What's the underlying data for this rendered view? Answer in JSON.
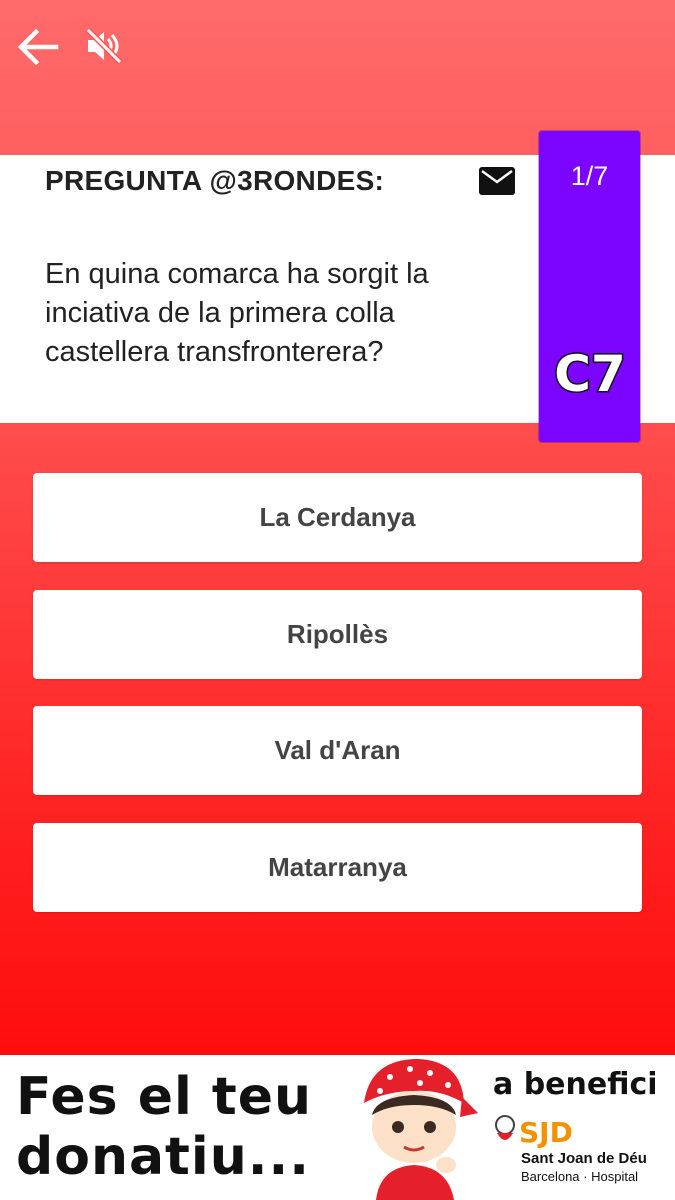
{
  "topbar": {
    "back_icon": "arrow-left-icon",
    "mute_icon": "speaker-muted-icon"
  },
  "question": {
    "title": "PREGUNTA @3RONDES:",
    "mail_icon": "envelope-icon",
    "text": "En quina comarca ha sorgit la inciativa de la primera colla castellera transfronterera?"
  },
  "counter": {
    "progress": "1/7",
    "logo_text": "C7"
  },
  "answers": [
    {
      "label": "La Cerdanya"
    },
    {
      "label": "Ripollès"
    },
    {
      "label": "Val d'Aran"
    },
    {
      "label": "Matarranya"
    }
  ],
  "banner": {
    "line1": "Fes el teu",
    "line2": "donatiu...",
    "benefici": "a benefici",
    "sjd_logo": "SJD",
    "sjd_name": "Sant Joan de Déu",
    "sjd_sub": "Barcelona · Hospital"
  },
  "colors": {
    "accent_purple": "#7c05ff",
    "background_red": "#ff1f1f",
    "sjd_red": "#e4202a",
    "sjd_orange": "#f39200"
  }
}
